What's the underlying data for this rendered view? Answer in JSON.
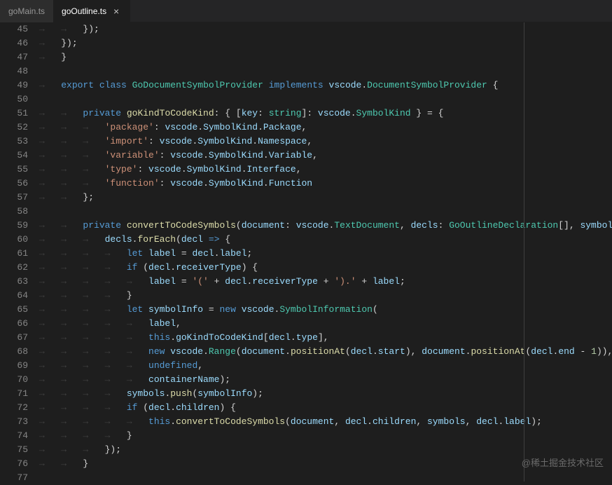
{
  "tabs": [
    {
      "label": "goMain.ts",
      "active": false
    },
    {
      "label": "goOutline.ts",
      "active": true
    }
  ],
  "startLine": 45,
  "endLine": 77,
  "watermark": "@稀土掘金技术社区",
  "lines": {
    "45": [
      [
        "ws",
        "→   →   "
      ],
      [
        "pun",
        "});"
      ]
    ],
    "46": [
      [
        "ws",
        "→   "
      ],
      [
        "pun",
        "});"
      ]
    ],
    "47": [
      [
        "ws",
        "→   "
      ],
      [
        "pun",
        "}"
      ]
    ],
    "48": [],
    "49": [
      [
        "ws",
        "→   "
      ],
      [
        "kw",
        "export"
      ],
      [
        "pun",
        " "
      ],
      [
        "kw",
        "class"
      ],
      [
        "pun",
        " "
      ],
      [
        "cls",
        "GoDocumentSymbolProvider"
      ],
      [
        "pun",
        " "
      ],
      [
        "kw",
        "implements"
      ],
      [
        "pun",
        " "
      ],
      [
        "prop",
        "vscode"
      ],
      [
        "pun",
        "."
      ],
      [
        "type",
        "DocumentSymbolProvider"
      ],
      [
        "pun",
        " {"
      ]
    ],
    "50": [],
    "51": [
      [
        "ws",
        "→   →   "
      ],
      [
        "kw",
        "private"
      ],
      [
        "pun",
        " "
      ],
      [
        "fn",
        "goKindToCodeKind"
      ],
      [
        "pun",
        ": { ["
      ],
      [
        "prop",
        "key"
      ],
      [
        "pun",
        ": "
      ],
      [
        "cls",
        "string"
      ],
      [
        "pun",
        "]: "
      ],
      [
        "prop",
        "vscode"
      ],
      [
        "pun",
        "."
      ],
      [
        "type",
        "SymbolKind"
      ],
      [
        "pun",
        " } = {"
      ]
    ],
    "52": [
      [
        "ws",
        "→   →   →   "
      ],
      [
        "str",
        "'package'"
      ],
      [
        "pun",
        ": "
      ],
      [
        "prop",
        "vscode"
      ],
      [
        "pun",
        "."
      ],
      [
        "prop",
        "SymbolKind"
      ],
      [
        "pun",
        "."
      ],
      [
        "prop",
        "Package"
      ],
      [
        "pun",
        ","
      ]
    ],
    "53": [
      [
        "ws",
        "→   →   →   "
      ],
      [
        "str",
        "'import'"
      ],
      [
        "pun",
        ": "
      ],
      [
        "prop",
        "vscode"
      ],
      [
        "pun",
        "."
      ],
      [
        "prop",
        "SymbolKind"
      ],
      [
        "pun",
        "."
      ],
      [
        "prop",
        "Namespace"
      ],
      [
        "pun",
        ","
      ]
    ],
    "54": [
      [
        "ws",
        "→   →   →   "
      ],
      [
        "str",
        "'variable'"
      ],
      [
        "pun",
        ": "
      ],
      [
        "prop",
        "vscode"
      ],
      [
        "pun",
        "."
      ],
      [
        "prop",
        "SymbolKind"
      ],
      [
        "pun",
        "."
      ],
      [
        "prop",
        "Variable"
      ],
      [
        "pun",
        ","
      ]
    ],
    "55": [
      [
        "ws",
        "→   →   →   "
      ],
      [
        "str",
        "'type'"
      ],
      [
        "pun",
        ": "
      ],
      [
        "prop",
        "vscode"
      ],
      [
        "pun",
        "."
      ],
      [
        "prop",
        "SymbolKind"
      ],
      [
        "pun",
        "."
      ],
      [
        "prop",
        "Interface"
      ],
      [
        "pun",
        ","
      ]
    ],
    "56": [
      [
        "ws",
        "→   →   →   "
      ],
      [
        "str",
        "'function'"
      ],
      [
        "pun",
        ": "
      ],
      [
        "prop",
        "vscode"
      ],
      [
        "pun",
        "."
      ],
      [
        "prop",
        "SymbolKind"
      ],
      [
        "pun",
        "."
      ],
      [
        "prop",
        "Function"
      ]
    ],
    "57": [
      [
        "ws",
        "→   →   "
      ],
      [
        "pun",
        "};"
      ]
    ],
    "58": [],
    "59": [
      [
        "ws",
        "→   →   "
      ],
      [
        "kw",
        "private"
      ],
      [
        "pun",
        " "
      ],
      [
        "fn",
        "convertToCodeSymbols"
      ],
      [
        "pun",
        "("
      ],
      [
        "prop",
        "document"
      ],
      [
        "pun",
        ": "
      ],
      [
        "prop",
        "vscode"
      ],
      [
        "pun",
        "."
      ],
      [
        "type",
        "TextDocument"
      ],
      [
        "pun",
        ", "
      ],
      [
        "prop",
        "decls"
      ],
      [
        "pun",
        ": "
      ],
      [
        "type",
        "GoOutlineDeclaration"
      ],
      [
        "pun",
        "[], "
      ],
      [
        "prop",
        "symbols"
      ],
      [
        "pun",
        ":"
      ]
    ],
    "60": [
      [
        "ws",
        "→   →   →   "
      ],
      [
        "prop",
        "decls"
      ],
      [
        "pun",
        "."
      ],
      [
        "fn",
        "forEach"
      ],
      [
        "pun",
        "("
      ],
      [
        "prop",
        "decl"
      ],
      [
        "pun",
        " "
      ],
      [
        "kw",
        "=>"
      ],
      [
        "pun",
        " {"
      ]
    ],
    "61": [
      [
        "ws",
        "→   →   →   →   "
      ],
      [
        "kw",
        "let"
      ],
      [
        "pun",
        " "
      ],
      [
        "prop",
        "label"
      ],
      [
        "pun",
        " = "
      ],
      [
        "prop",
        "decl"
      ],
      [
        "pun",
        "."
      ],
      [
        "prop",
        "label"
      ],
      [
        "pun",
        ";"
      ]
    ],
    "62": [
      [
        "ws",
        "→   →   →   →   "
      ],
      [
        "kw",
        "if"
      ],
      [
        "pun",
        " ("
      ],
      [
        "prop",
        "decl"
      ],
      [
        "pun",
        "."
      ],
      [
        "prop",
        "receiverType"
      ],
      [
        "pun",
        ") {"
      ]
    ],
    "63": [
      [
        "ws",
        "→   →   →   →   →   "
      ],
      [
        "prop",
        "label"
      ],
      [
        "pun",
        " = "
      ],
      [
        "str",
        "'('"
      ],
      [
        "pun",
        " + "
      ],
      [
        "prop",
        "decl"
      ],
      [
        "pun",
        "."
      ],
      [
        "prop",
        "receiverType"
      ],
      [
        "pun",
        " + "
      ],
      [
        "str",
        "').'"
      ],
      [
        "pun",
        " + "
      ],
      [
        "prop",
        "label"
      ],
      [
        "pun",
        ";"
      ]
    ],
    "64": [
      [
        "ws",
        "→   →   →   →   "
      ],
      [
        "pun",
        "}"
      ]
    ],
    "65": [
      [
        "ws",
        "→   →   →   →   "
      ],
      [
        "kw",
        "let"
      ],
      [
        "pun",
        " "
      ],
      [
        "prop",
        "symbolInfo"
      ],
      [
        "pun",
        " = "
      ],
      [
        "kw",
        "new"
      ],
      [
        "pun",
        " "
      ],
      [
        "prop",
        "vscode"
      ],
      [
        "pun",
        "."
      ],
      [
        "type",
        "SymbolInformation"
      ],
      [
        "pun",
        "("
      ]
    ],
    "66": [
      [
        "ws",
        "→   →   →   →   →   "
      ],
      [
        "prop",
        "label"
      ],
      [
        "pun",
        ","
      ]
    ],
    "67": [
      [
        "ws",
        "→   →   →   →   →   "
      ],
      [
        "kw",
        "this"
      ],
      [
        "pun",
        "."
      ],
      [
        "prop",
        "goKindToCodeKind"
      ],
      [
        "pun",
        "["
      ],
      [
        "prop",
        "decl"
      ],
      [
        "pun",
        "."
      ],
      [
        "prop",
        "type"
      ],
      [
        "pun",
        "],"
      ]
    ],
    "68": [
      [
        "ws",
        "→   →   →   →   →   "
      ],
      [
        "kw",
        "new"
      ],
      [
        "pun",
        " "
      ],
      [
        "prop",
        "vscode"
      ],
      [
        "pun",
        "."
      ],
      [
        "type",
        "Range"
      ],
      [
        "pun",
        "("
      ],
      [
        "prop",
        "document"
      ],
      [
        "pun",
        "."
      ],
      [
        "fn",
        "positionAt"
      ],
      [
        "pun",
        "("
      ],
      [
        "prop",
        "decl"
      ],
      [
        "pun",
        "."
      ],
      [
        "prop",
        "start"
      ],
      [
        "pun",
        "), "
      ],
      [
        "prop",
        "document"
      ],
      [
        "pun",
        "."
      ],
      [
        "fn",
        "positionAt"
      ],
      [
        "pun",
        "("
      ],
      [
        "prop",
        "decl"
      ],
      [
        "pun",
        "."
      ],
      [
        "prop",
        "end"
      ],
      [
        "pun",
        " - "
      ],
      [
        "num",
        "1"
      ],
      [
        "pun",
        ")),"
      ]
    ],
    "69": [
      [
        "ws",
        "→   →   →   →   →   "
      ],
      [
        "kw",
        "undefined"
      ],
      [
        "pun",
        ","
      ]
    ],
    "70": [
      [
        "ws",
        "→   →   →   →   →   "
      ],
      [
        "prop",
        "containerName"
      ],
      [
        "pun",
        ");"
      ]
    ],
    "71": [
      [
        "ws",
        "→   →   →   →   "
      ],
      [
        "prop",
        "symbols"
      ],
      [
        "pun",
        "."
      ],
      [
        "fn",
        "push"
      ],
      [
        "pun",
        "("
      ],
      [
        "prop",
        "symbolInfo"
      ],
      [
        "pun",
        ");"
      ]
    ],
    "72": [
      [
        "ws",
        "→   →   →   →   "
      ],
      [
        "kw",
        "if"
      ],
      [
        "pun",
        " ("
      ],
      [
        "prop",
        "decl"
      ],
      [
        "pun",
        "."
      ],
      [
        "prop",
        "children"
      ],
      [
        "pun",
        ") {"
      ]
    ],
    "73": [
      [
        "ws",
        "→   →   →   →   →   "
      ],
      [
        "kw",
        "this"
      ],
      [
        "pun",
        "."
      ],
      [
        "fn",
        "convertToCodeSymbols"
      ],
      [
        "pun",
        "("
      ],
      [
        "prop",
        "document"
      ],
      [
        "pun",
        ", "
      ],
      [
        "prop",
        "decl"
      ],
      [
        "pun",
        "."
      ],
      [
        "prop",
        "children"
      ],
      [
        "pun",
        ", "
      ],
      [
        "prop",
        "symbols"
      ],
      [
        "pun",
        ", "
      ],
      [
        "prop",
        "decl"
      ],
      [
        "pun",
        "."
      ],
      [
        "prop",
        "label"
      ],
      [
        "pun",
        ");"
      ]
    ],
    "74": [
      [
        "ws",
        "→   →   →   →   "
      ],
      [
        "pun",
        "}"
      ]
    ],
    "75": [
      [
        "ws",
        "→   →   →   "
      ],
      [
        "pun",
        "});"
      ]
    ],
    "76": [
      [
        "ws",
        "→   →   "
      ],
      [
        "pun",
        "}"
      ]
    ],
    "77": []
  }
}
